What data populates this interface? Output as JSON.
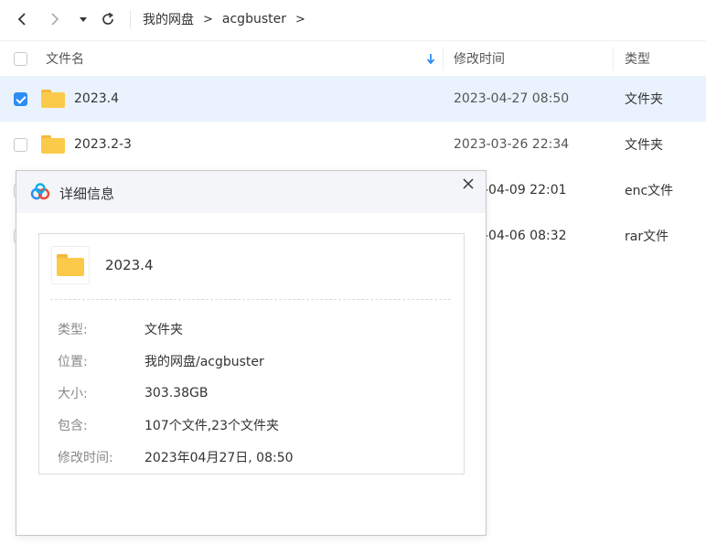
{
  "nav": {
    "back_icon": "‹",
    "forward_icon": "›",
    "dropdown_icon": "▾",
    "refresh_icon": "⟳",
    "breadcrumb": [
      "我的网盘",
      "acgbuster"
    ],
    "separator": ">"
  },
  "table": {
    "headers": {
      "name": "文件名",
      "time": "修改时间",
      "type": "类型"
    },
    "rows": [
      {
        "name": "2023.4",
        "time": "2023-04-27 08:50",
        "type": "文件夹",
        "checked": true
      },
      {
        "name": "2023.2-3",
        "time": "2023-03-26 22:34",
        "type": "文件夹",
        "checked": false
      },
      {
        "name": "",
        "time": "-04-09 22:01",
        "type": "enc文件",
        "checked": false
      },
      {
        "name": "",
        "time": "-04-06 08:32",
        "type": "rar文件",
        "checked": false
      }
    ]
  },
  "dialog": {
    "title": "详细信息",
    "file_name": "2023.4",
    "fields": [
      {
        "label": "类型:",
        "value": "文件夹"
      },
      {
        "label": "位置:",
        "value": "我的网盘/acgbuster"
      },
      {
        "label": "大小:",
        "value": "303.38GB"
      },
      {
        "label": "包含:",
        "value": "107个文件,23个文件夹"
      },
      {
        "label": "修改时间:",
        "value": "2023年04月27日, 08:50"
      }
    ]
  },
  "colors": {
    "accent": "#2c8df3",
    "selected_row": "#eaf3fd",
    "folder": "#fcca4a"
  }
}
